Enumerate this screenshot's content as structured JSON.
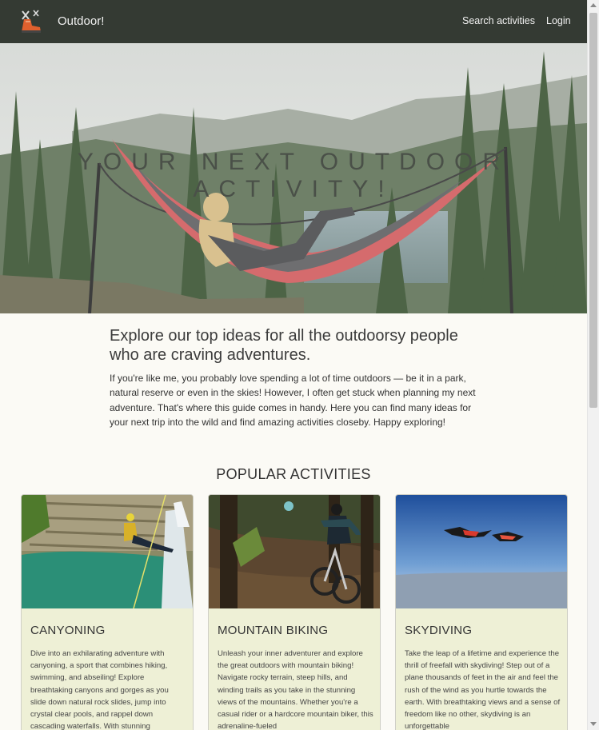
{
  "navbar": {
    "brand": "Outdoor!",
    "logo_icon": "hiking-boot-logo-icon",
    "links": [
      "Search activities",
      "Login"
    ]
  },
  "hero": {
    "title": "YOUR NEXT OUTDOOR ACTIVITY!",
    "image": "person-in-hammock-forest-lake-image"
  },
  "intro": {
    "heading": "Explore our top ideas for all the outdoorsy people who are craving adventures.",
    "body": "If you're like me, you probably love spending a lot of time outdoors — be it in a park, natural reserve or even in the skies! However, I often get stuck when planning my next adventure. That's where this guide comes in handy. Here you can find many ideas for your next trip into the wild and find amazing activities closeby. Happy exploring!"
  },
  "popular": {
    "title": "POPULAR ACTIVITIES",
    "cards": [
      {
        "title": "CANYONING",
        "image": "canyoning-waterfall-image",
        "text": "Dive into an exhilarating adventure with canyoning, a sport that combines hiking, swimming, and abseiling! Explore breathtaking canyons and gorges as you slide down natural rock slides, jump into crystal clear pools, and rappel down cascading waterfalls. With stunning"
      },
      {
        "title": "MOUNTAIN BIKING",
        "image": "mountain-biking-forest-image",
        "text": "Unleash your inner adventurer and explore the great outdoors with mountain biking! Navigate rocky terrain, steep hills, and winding trails as you take in the stunning views of the mountains. Whether you're a casual rider or a hardcore mountain biker, this adrenaline-fueled"
      },
      {
        "title": "SKYDIVING",
        "image": "skydiving-sky-image",
        "text": "Take the leap of a lifetime and experience the thrill of freefall with skydiving! Step out of a plane thousands of feet in the air and feel the rush of the wind as you hurtle towards the earth. With breathtaking views and a sense of freedom like no other, skydiving is an unforgettable"
      }
    ]
  },
  "colors": {
    "navbar": "#343a33",
    "card_background": "#eef0d6",
    "page_background": "#fbfaf5"
  }
}
